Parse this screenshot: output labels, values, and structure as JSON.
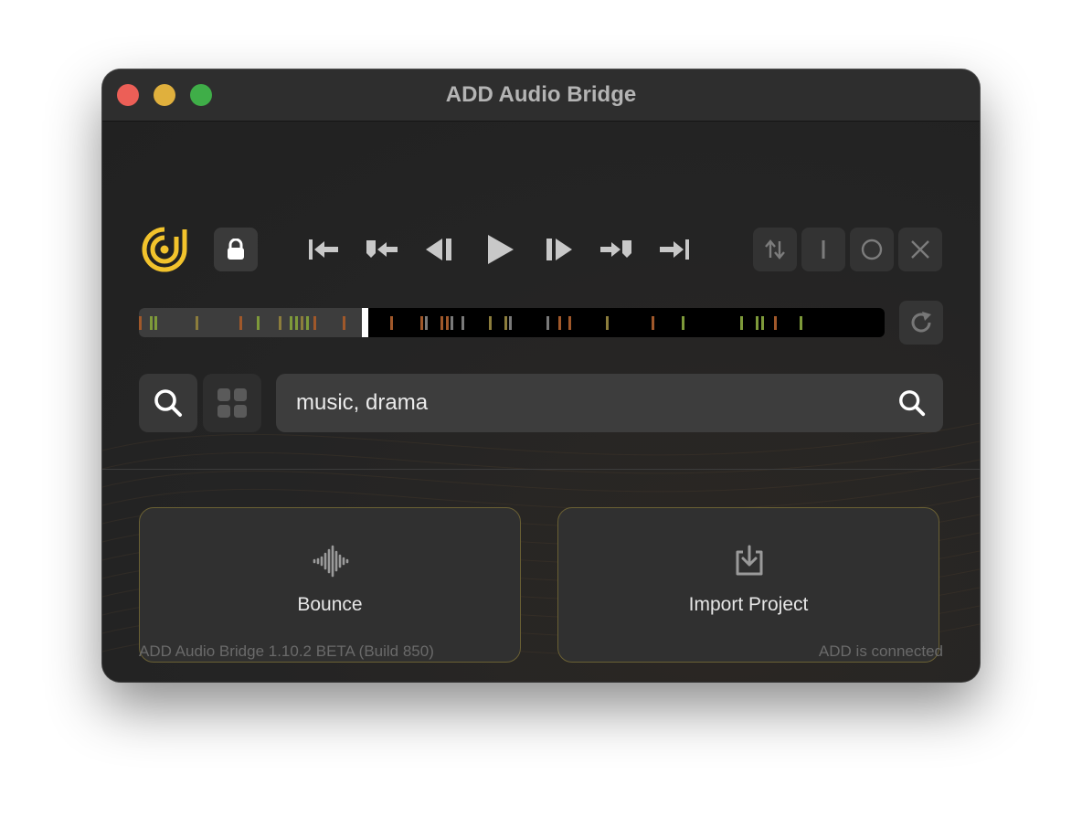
{
  "window": {
    "title": "ADD Audio Bridge"
  },
  "toolbar": {
    "logo_icon": "add-logo",
    "lock_icon": "lock-icon",
    "transport": [
      "go-to-start-icon",
      "previous-marker-icon",
      "step-back-icon",
      "play-icon",
      "step-forward-icon",
      "next-marker-icon",
      "go-to-end-icon"
    ],
    "modes": [
      "sort-arrows-icon",
      "insert-mode-icon",
      "record-mode-icon",
      "close-icon"
    ]
  },
  "timeline": {
    "progress_percent": 30,
    "refresh_icon": "refresh-icon"
  },
  "search": {
    "value": "music, drama",
    "search_icon": "search-icon",
    "grid_icon": "grid-icon"
  },
  "actions": {
    "bounce_label": "Bounce",
    "bounce_icon": "waveform-icon",
    "import_label": "Import Project",
    "import_icon": "import-icon"
  },
  "footer": {
    "version": "ADD Audio Bridge 1.10.2 BETA (Build 850)",
    "status": "ADD is connected"
  },
  "colors": {
    "accent_yellow": "#f2c32c",
    "marker_orange": "#a0582a",
    "marker_green": "#7e9a3a",
    "marker_olive": "#8c7d3c",
    "marker_gray": "#7a7a7a",
    "card_border": "#6a6034"
  }
}
